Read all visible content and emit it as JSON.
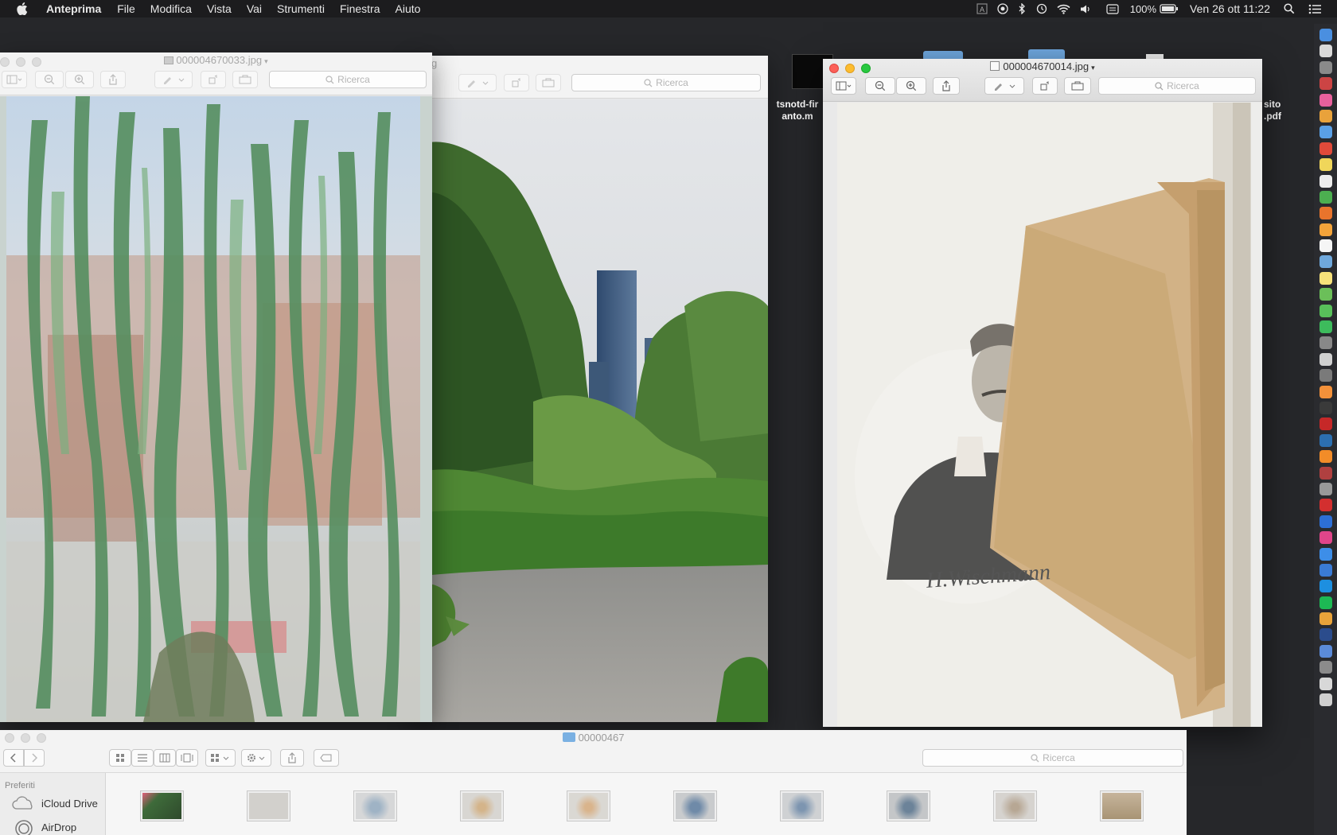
{
  "menubar": {
    "app_name": "Anteprima",
    "menus": [
      "File",
      "Modifica",
      "Vista",
      "Vai",
      "Strumenti",
      "Finestra",
      "Aiuto"
    ],
    "battery": "100%",
    "datetime": "Ven 26 ott  11:22"
  },
  "desktop": {
    "items": [
      {
        "label": "tsnotd-fir\nanto.m"
      },
      {
        "label": "sito\n.pdf"
      }
    ]
  },
  "windows": {
    "back": {
      "title": "000004670033.jpg",
      "search_placeholder": "Ricerca",
      "title_suffix": "g"
    },
    "middle": {
      "search_placeholder": "Ricerca"
    },
    "front": {
      "title": "000004670014.jpg",
      "search_placeholder": "Ricerca",
      "signature": "H.Wischmann"
    }
  },
  "finder": {
    "title": "00000467",
    "search_placeholder": "Ricerca",
    "sidebar_header": "Preferiti",
    "sidebar_items": [
      "iCloud Drive",
      "AirDrop"
    ],
    "thumbnail_count": 10
  },
  "colors": {
    "desktop": "#26272a",
    "menubar": "#1c1c1e",
    "close": "#fc5f57",
    "minimize": "#fdbc2e",
    "zoom": "#28c840",
    "folder": "#6fa8e0"
  },
  "dock_icons": [
    "finder-icon",
    "safari-icon",
    "launchpad-icon",
    "system-icon",
    "music-icon",
    "photos-icon",
    "mail-icon",
    "calendar-icon",
    "notes-icon",
    "reminders-icon",
    "chrome-icon",
    "firefox-icon",
    "pages-icon",
    "textedit-icon",
    "preview-icon",
    "stickies-icon",
    "maps-icon",
    "messages-icon",
    "facetime-icon",
    "camera-icon",
    "iphoto-icon",
    "imovie-icon",
    "garageband-icon",
    "finalcut-icon",
    "filezilla-icon",
    "wordpress-icon",
    "vlc-icon",
    "photobooth-icon",
    "capture-icon",
    "acrobat-icon",
    "photoshop-icon",
    "indesign-icon",
    "appstore-icon",
    "xcode-icon",
    "skype-icon",
    "spotify-icon",
    "books-icon",
    "bbedit-icon",
    "network-icon",
    "tools-icon",
    "help-icon",
    "trash-icon"
  ]
}
